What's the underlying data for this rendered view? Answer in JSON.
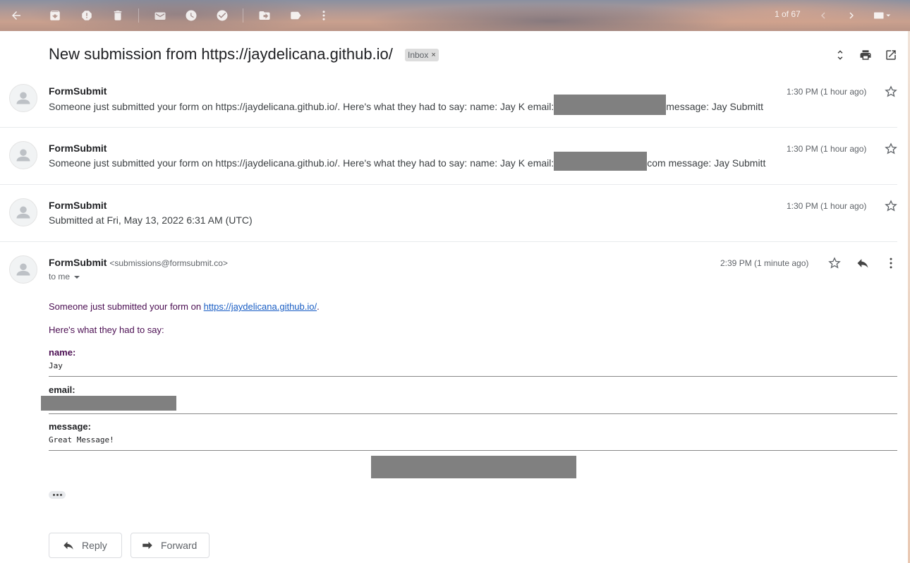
{
  "toolbar": {
    "pager": "1 of 67",
    "icons": [
      "back-arrow-icon",
      "archive-icon",
      "report-spam-icon",
      "delete-icon",
      "mark-unread-icon",
      "snooze-icon",
      "add-to-tasks-icon",
      "move-to-icon",
      "label-icon",
      "more-icon",
      "newer-icon",
      "older-icon",
      "keyboard-icon"
    ]
  },
  "thread": {
    "subject": "New submission from https://jaydelicana.github.io/",
    "label": "Inbox",
    "label_remove": "×"
  },
  "messages": [
    {
      "sender": "FormSubmit",
      "snippet_before": "Someone just submitted your form on https://jaydelicana.github.io/. Here's what they had to say: name: Jay K email:",
      "snippet_after": "message: Jay Submitt",
      "time": "1:30 PM (1 hour ago)"
    },
    {
      "sender": "FormSubmit",
      "snippet_before": "Someone just submitted your form on https://jaydelicana.github.io/. Here's what they had to say: name: Jay K email:",
      "snippet_after": "com message: Jay Submitt",
      "time": "1:30 PM (1 hour ago)"
    },
    {
      "sender": "FormSubmit",
      "snippet": "Submitted at Fri, May 13, 2022 6:31 AM (UTC)",
      "time": "1:30 PM (1 hour ago)"
    }
  ],
  "open_message": {
    "sender": "FormSubmit",
    "email": "<submissions@formsubmit.co>",
    "to": "to me",
    "time": "2:39 PM (1 minute ago)",
    "intro_before": "Someone just submitted your form on ",
    "intro_link": "https://jaydelicana.github.io/",
    "intro_after": ".",
    "intro2": "Here's what they had to say:",
    "fields": {
      "name_label": "name:",
      "name_value": "Jay",
      "email_label": "email:",
      "message_label": "message:",
      "message_value": "Great Message!"
    }
  },
  "actions": {
    "reply": "Reply",
    "forward": "Forward"
  }
}
